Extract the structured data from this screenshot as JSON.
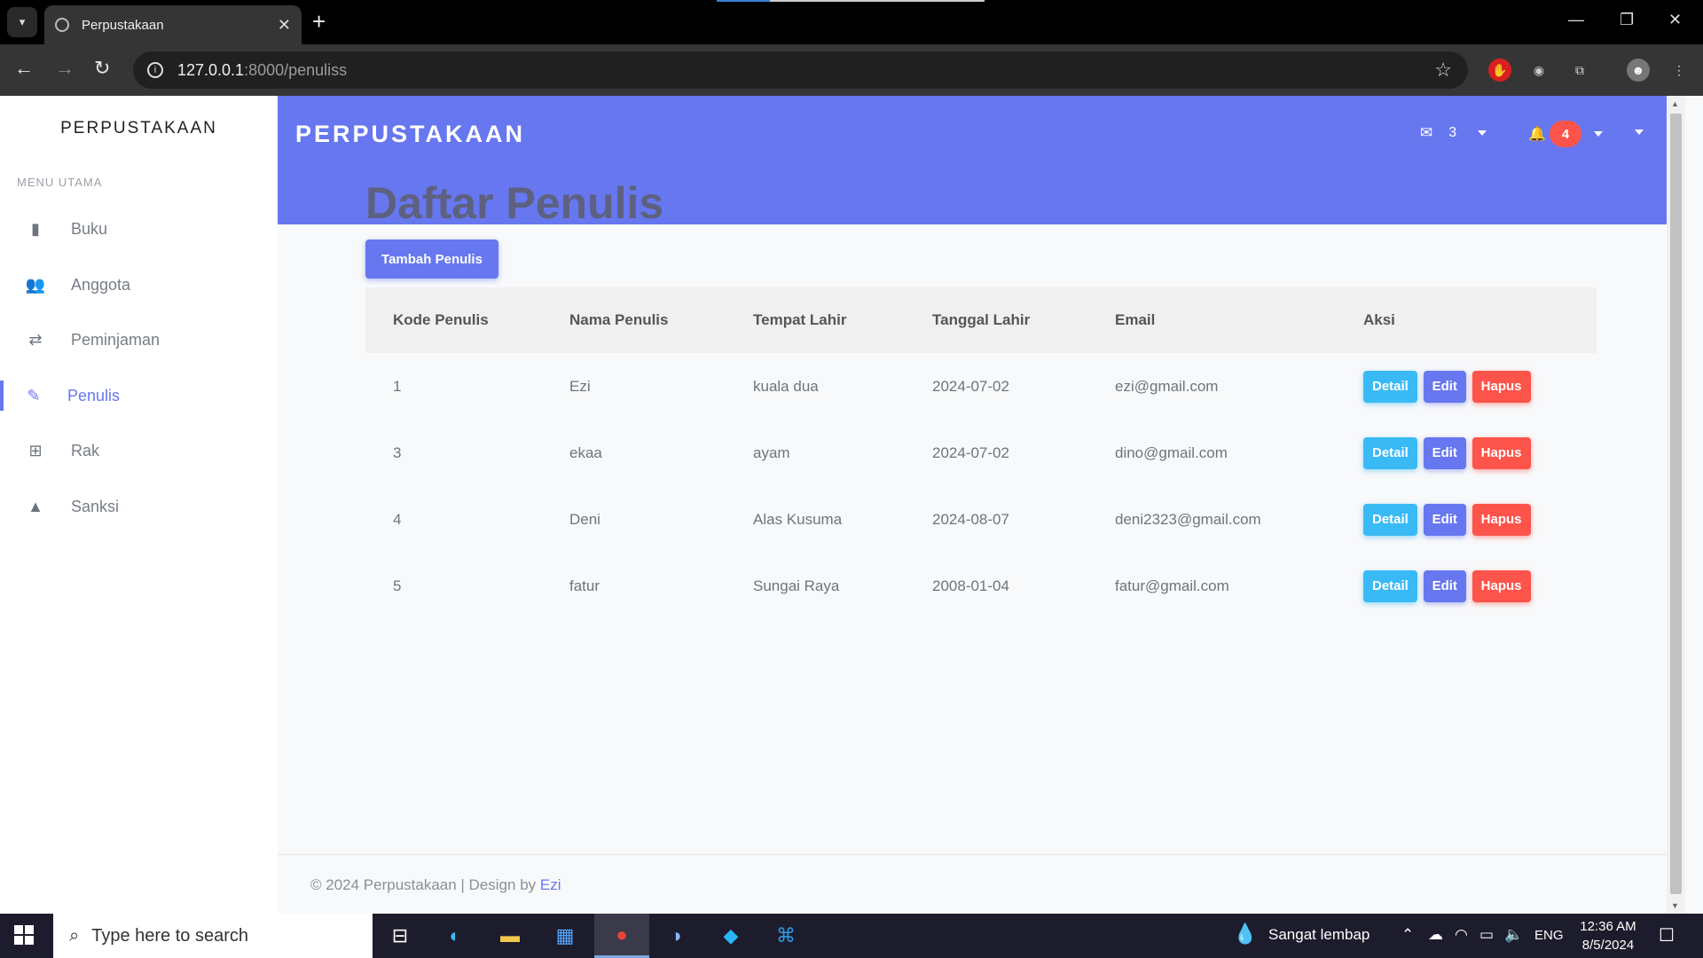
{
  "browser": {
    "tab_title": "Perpustakaan",
    "url_host": "127.0.0.1",
    "url_path": ":8000/penuliss"
  },
  "sidebar": {
    "brand": "PERPUSTAKAAN",
    "menu_heading": "MENU UTAMA",
    "items": [
      {
        "label": "Buku",
        "icon": "book-icon"
      },
      {
        "label": "Anggota",
        "icon": "users-icon"
      },
      {
        "label": "Peminjaman",
        "icon": "exchange-icon"
      },
      {
        "label": "Penulis",
        "icon": "pencil-icon",
        "active": true
      },
      {
        "label": "Rak",
        "icon": "sitemap-icon"
      },
      {
        "label": "Sanksi",
        "icon": "warning-icon"
      }
    ]
  },
  "navbar": {
    "brand": "PERPUSTAKAAN",
    "messages_count": "3",
    "notifications_count": "4"
  },
  "main": {
    "title": "Daftar Penulis",
    "add_button": "Tambah Penulis",
    "table": {
      "headers": [
        "Kode Penulis",
        "Nama Penulis",
        "Tempat Lahir",
        "Tanggal Lahir",
        "Email",
        "Aksi"
      ],
      "rows": [
        [
          "1",
          "Ezi",
          "kuala dua",
          "2024-07-02",
          "ezi@gmail.com"
        ],
        [
          "3",
          "ekaa",
          "ayam",
          "2024-07-02",
          "dino@gmail.com"
        ],
        [
          "4",
          "Deni",
          "Alas Kusuma",
          "2024-08-07",
          "deni2323@gmail.com"
        ],
        [
          "5",
          "fatur",
          "Sungai Raya",
          "2008-01-04",
          "fatur@gmail.com"
        ]
      ],
      "actions": {
        "detail": "Detail",
        "edit": "Edit",
        "delete": "Hapus"
      }
    }
  },
  "footer": {
    "text": "© 2024 Perpustakaan | Design by",
    "author": "Ezi"
  },
  "taskbar": {
    "search_placeholder": "Type here to search",
    "weather": "Sangat lembap",
    "language": "ENG",
    "time": "12:36 AM",
    "date": "8/5/2024"
  },
  "colors": {
    "primary": "#6777ef",
    "info": "#3abaf4",
    "danger": "#fc544b"
  }
}
